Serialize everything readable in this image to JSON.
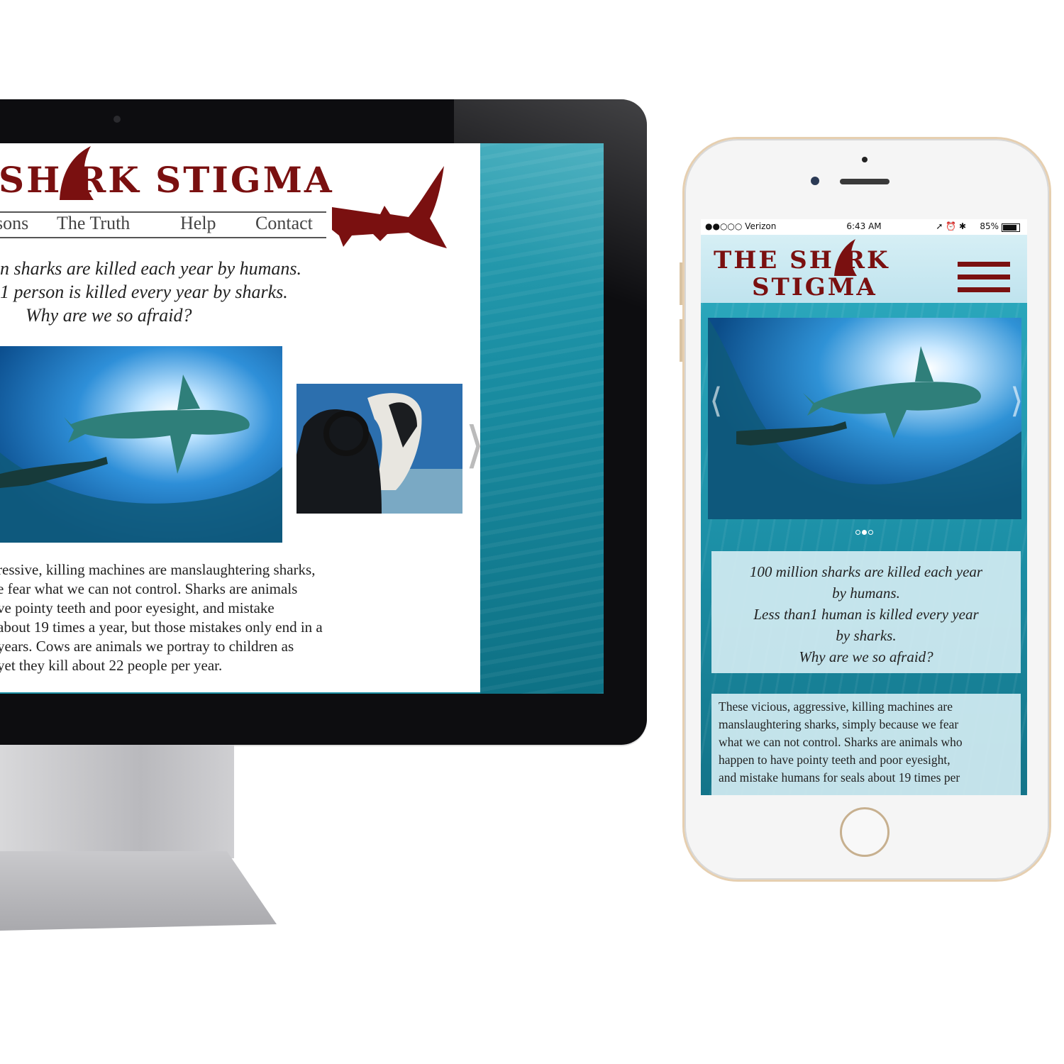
{
  "desktop": {
    "site_title": "SH RK STIGMA",
    "nav": [
      "sons",
      "The Truth",
      "Help",
      "Contact"
    ],
    "tagline": [
      "n sharks are killed each year by humans.",
      "1 person is killed every year by sharks.",
      "Why are we so afraid?"
    ],
    "body_text": [
      "ressive, killing machines are manslaughtering sharks,",
      "e fear what we can not control. Sharks are animals",
      "ve pointy teeth and poor eyesight, and mistake",
      "about 19 times a year, but those mistakes only end in a",
      "years. Cows are animals we portray to children as",
      "yet they kill about 22 people per year."
    ],
    "carousel_next": "⟩"
  },
  "phone": {
    "status": {
      "carrier": "●●○○○ Verizon",
      "time": "6:43 AM",
      "battery": "85%",
      "battery_level": 0.85
    },
    "title_line1": "THE SH RK",
    "title_line2": "STIGMA",
    "carousel_prev": "⟨",
    "carousel_next": "⟩",
    "slides_total": 3,
    "slide_active": 1,
    "tagline": [
      "100 million sharks are killed each year",
      "by humans.",
      "Less than1 human is killed every year",
      "by sharks.",
      "Why are we so afraid?"
    ],
    "body_text": [
      "These vicious, aggressive, killing machines are",
      "manslaughtering sharks, simply because we fear",
      "what we can not control. Sharks are animals who",
      "happen to have pointy teeth and poor eyesight,",
      "and mistake humans for seals about 19 times per"
    ]
  },
  "colors": {
    "brand": "#7a1010",
    "ocean": "#1b8399"
  }
}
